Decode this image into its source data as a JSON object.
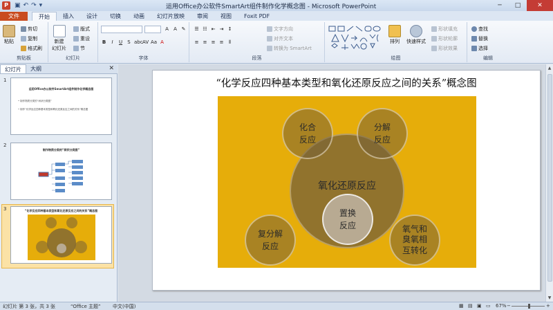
{
  "app": {
    "icon_letter": "P",
    "window_title": "运用Office办公软件SmartArt组件制作化学概念图 - Microsoft PowerPoint",
    "controls": {
      "minimize": "─",
      "maximize": "□",
      "close": "✕"
    }
  },
  "ribbon_tabs": [
    "文件",
    "开始",
    "插入",
    "设计",
    "切换",
    "动画",
    "幻灯片放映",
    "审阅",
    "视图",
    "Foxit PDF"
  ],
  "ribbon": {
    "clipboard": {
      "label": "剪贴板",
      "paste": "粘贴",
      "cut": "剪切",
      "copy": "复制",
      "format_painter": "格式刷"
    },
    "slides": {
      "label": "幻灯片",
      "new_slide_1": "新建",
      "new_slide_2": "幻灯片",
      "layout": "版式",
      "reset": "重设",
      "section": "节"
    },
    "font": {
      "label": "字体"
    },
    "paragraph": {
      "label": "段落",
      "text_direction": "文字方向",
      "align_text": "对齐文本",
      "convert_smartart": "转换为 SmartArt"
    },
    "drawing": {
      "label": "绘图",
      "arrange": "排列",
      "quick_styles": "快速样式",
      "shape_fill": "形状填充",
      "shape_outline": "形状轮廓",
      "shape_effects": "形状效果"
    },
    "editing": {
      "label": "编辑",
      "find": "查找",
      "replace": "替换",
      "select": "选择"
    }
  },
  "left_pane": {
    "tabs": [
      "幻灯片",
      "大纲"
    ],
    "close": "✕",
    "thumbnails": [
      {
        "number": "1",
        "title": "运用Office办公软件SmartArt组件制作化学概念图",
        "lines": [
          "• 制作物质分类的“树状分类图”",
          "• 制作“化学反应四种基本类型和氧化还原反应之间的关系”概念图"
        ]
      },
      {
        "number": "2",
        "title": "制作物质分类的“树状分类图”",
        "lines": []
      },
      {
        "number": "3",
        "title": "“化学反应四种基本类型和氧化还原反应之间的关系”概念图",
        "lines": []
      }
    ]
  },
  "slide": {
    "title": "“化学反应四种基本类型和氧化还原反应之间的关系”概念图",
    "diagram": {
      "background_color": "#e6ad0a",
      "center_label": "氧化还原反应",
      "combination": [
        "化合",
        "反应"
      ],
      "decomposition": [
        "分解",
        "反应"
      ],
      "displacement": [
        "置换",
        "反应"
      ],
      "double_decomposition": [
        "复分解",
        "反应"
      ],
      "ozone": [
        "氧气和",
        "臭氧相",
        "互转化"
      ]
    }
  },
  "statusbar": {
    "slide_info": "幻灯片 第 3 张，共 3 张",
    "theme": "“Office 主题”",
    "language": "中文(中国)",
    "zoom": "67%",
    "zoom_out": "−",
    "zoom_in": "+"
  }
}
